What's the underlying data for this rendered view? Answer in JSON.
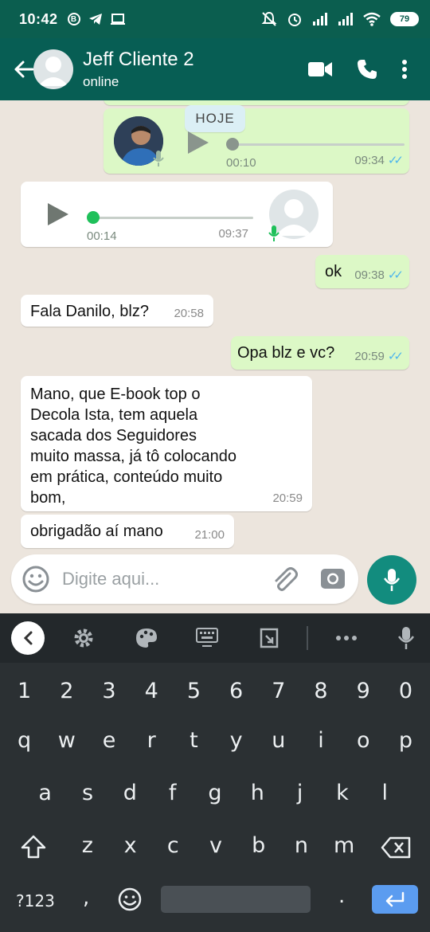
{
  "status_bar": {
    "time": "10:42",
    "b_badge": "B",
    "battery": "79"
  },
  "header": {
    "contact_name": "Jeff Cliente 2",
    "contact_status": "online"
  },
  "chat": {
    "date_chip": "HOJE",
    "voice_out": {
      "duration": "00:10",
      "time": "09:34"
    },
    "voice_in": {
      "duration": "00:14",
      "time": "09:37"
    },
    "messages": [
      {
        "direction": "out",
        "text": "ok",
        "time": "09:38"
      },
      {
        "direction": "in",
        "text": "Fala Danilo, blz?",
        "time": "20:58"
      },
      {
        "direction": "out",
        "text": "Opa blz e vc?",
        "time": "20:59"
      },
      {
        "direction": "in",
        "lines": [
          "Mano, que E-book top o",
          "Decola Ista, tem aquela",
          "sacada dos Seguidores",
          "muito massa, já tô colocando",
          "em prática, conteúdo muito",
          "bom,"
        ],
        "time": "20:59"
      },
      {
        "direction": "in",
        "text": "obrigadão aí mano",
        "time": "21:00"
      }
    ]
  },
  "input": {
    "placeholder": "Digite aqui..."
  },
  "keyboard": {
    "row_numbers": [
      "1",
      "2",
      "3",
      "4",
      "5",
      "6",
      "7",
      "8",
      "9",
      "0"
    ],
    "row1": [
      "q",
      "w",
      "e",
      "r",
      "t",
      "y",
      "u",
      "i",
      "o",
      "p"
    ],
    "row2": [
      "a",
      "s",
      "d",
      "f",
      "g",
      "h",
      "j",
      "k",
      "l"
    ],
    "row3": [
      "z",
      "x",
      "c",
      "v",
      "b",
      "n",
      "m"
    ],
    "symbols_key": "?123",
    "comma_key": ",",
    "period_key": "."
  },
  "colors": {
    "header": "#075e54",
    "status_bar": "#0b5e4f",
    "outgoing_bubble": "#dcf8c6",
    "incoming_bubble": "#ffffff",
    "read_ticks": "#4fb6ec",
    "mic_button": "#128c7e",
    "keyboard_bg": "#2b3033"
  }
}
